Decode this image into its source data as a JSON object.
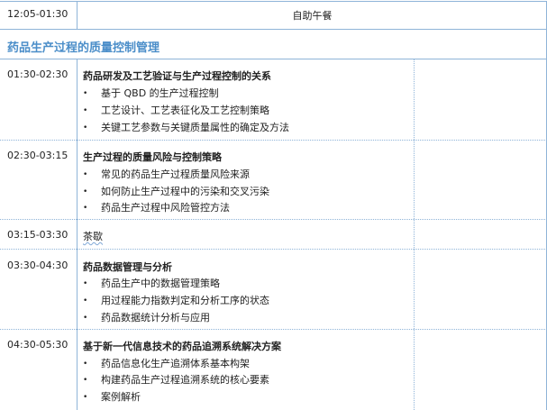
{
  "lunch": {
    "time": "12:05-01:30",
    "label": "自助午餐"
  },
  "section": {
    "title": "药品生产过程的质量控制管理"
  },
  "sessions": [
    {
      "time": "01:30-02:30",
      "title": "药品研发及工艺验证与生产过程控制的关系",
      "items": [
        "基于 QBD 的生产过程控制",
        "工艺设计、工艺表征化及工艺控制策略",
        "关键工艺参数与关键质量属性的确定及方法"
      ]
    },
    {
      "time": "02:30-03:15",
      "title": "生产过程的质量风险与控制策略",
      "items": [
        "常见的药品生产过程质量风险来源",
        "如何防止生产过程中的污染和交叉污染",
        "药品生产过程中风险管控方法"
      ]
    },
    {
      "time": "03:15-03:30",
      "title": "茶歇",
      "items": []
    },
    {
      "time": "03:30-04:30",
      "title": "药品数据管理与分析",
      "items": [
        "药品生产中的数据管理策略",
        "用过程能力指数判定和分析工序的状态",
        "药品数据统计分析与应用"
      ]
    },
    {
      "time": "04:30-05:30",
      "title": "基于新一代信息技术的药品追溯系统解决方案",
      "items": [
        "药品信息化生产追溯体系基本构架",
        "构建药品生产过程追溯系统的核心要素",
        "案例解析"
      ]
    }
  ],
  "bullet_glyph": "•"
}
